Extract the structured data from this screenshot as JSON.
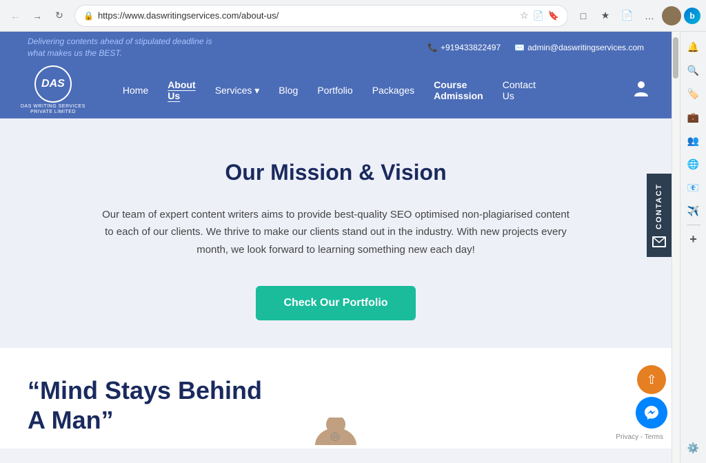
{
  "browser": {
    "url": "https://www.daswritingservices.com/about-us/",
    "back_disabled": true,
    "forward_disabled": false
  },
  "top_banner": {
    "tagline_line1": "Delivering contents ahead of stipulated deadline is",
    "tagline_line2": "what makes us the BEST.",
    "phone": "+919433822497",
    "email": "admin@daswritingservices.com"
  },
  "navbar": {
    "logo_text": "DAS",
    "logo_subtitle": "DAS WRITING SERVICES\nPRIVATE LIMITED",
    "items": [
      {
        "label": "Home",
        "active": false
      },
      {
        "label": "About Us",
        "active": true
      },
      {
        "label": "Services",
        "active": false,
        "has_dropdown": true
      },
      {
        "label": "Blog",
        "active": false
      },
      {
        "label": "Portfolio",
        "active": false
      },
      {
        "label": "Packages",
        "active": false
      },
      {
        "label": "Course Admission",
        "active": false,
        "bold": true
      },
      {
        "label": "Contact Us",
        "active": false
      }
    ]
  },
  "contact_sidebar": {
    "label": "CONTACT"
  },
  "main_section": {
    "title": "Our Mission & Vision",
    "body": "Our team of expert content writers aims to provide best-quality SEO optimised non-plagiarised content to each of our clients. We thrive to make our clients stand out in the industry. With new projects every month, we look forward to learning something new each day!",
    "cta_button": "Check Our Portfolio"
  },
  "lower_section": {
    "quote_line1": "“Mind Stays Behind",
    "quote_line2": "A Man”"
  },
  "privacy": {
    "text": "Privacy - Terms"
  },
  "right_sidebar": {
    "icons": [
      {
        "name": "bell-icon",
        "symbol": "🔔",
        "interactable": true
      },
      {
        "name": "search-icon",
        "symbol": "🔍",
        "interactable": true
      },
      {
        "name": "tag-icon",
        "symbol": "🏷️",
        "interactable": true
      },
      {
        "name": "briefcase-icon",
        "symbol": "💼",
        "interactable": true
      },
      {
        "name": "people-icon",
        "symbol": "👥",
        "interactable": true
      },
      {
        "name": "globe-icon",
        "symbol": "🌐",
        "interactable": true
      },
      {
        "name": "outlook-icon",
        "symbol": "📧",
        "interactable": true
      },
      {
        "name": "send-icon",
        "symbol": "✈️",
        "interactable": true
      },
      {
        "name": "add-icon",
        "symbol": "+",
        "interactable": true
      },
      {
        "name": "settings-icon",
        "symbol": "⚙️",
        "interactable": true
      }
    ]
  }
}
